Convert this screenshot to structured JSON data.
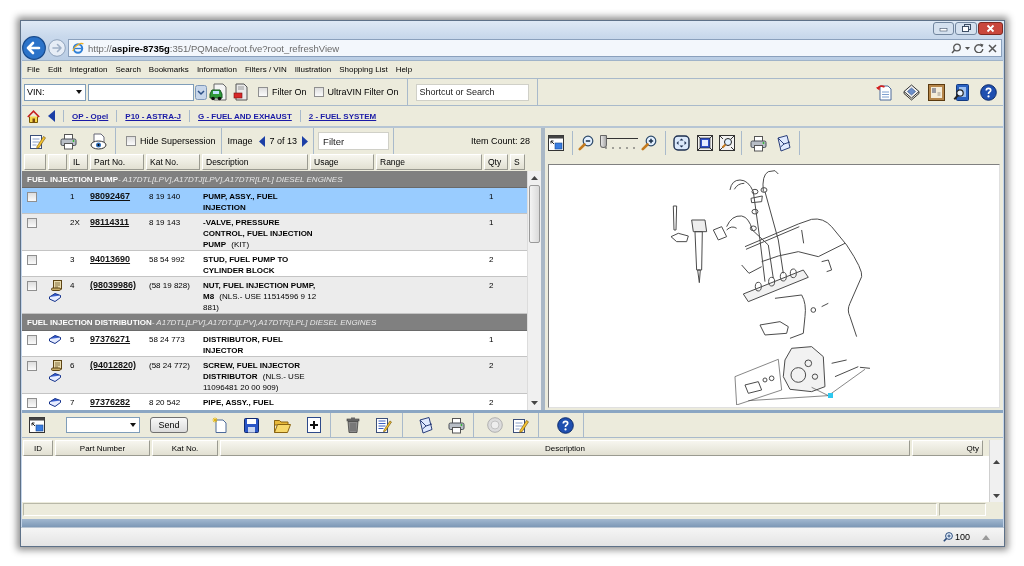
{
  "address_bar": {
    "url": "http://**aspire-8735g**:351/PQMace/root.fve?root_refreshView"
  },
  "menu": [
    "File",
    "Edit",
    "Integration",
    "Search",
    "Bookmarks",
    "Information",
    "Filters / VIN",
    "Illustration",
    "Shopping List",
    "Help"
  ],
  "toolbar": {
    "vin_select": "VIN:",
    "filters": [
      {
        "label": "Filter On",
        "checked": false
      },
      {
        "label": "UltraVIN Filter On",
        "checked": false
      }
    ],
    "search": {
      "placeholder": "Shortcut or Search"
    }
  },
  "breadcrumb": [
    "OP - Opel",
    "P10 - ASTRA-J",
    "G - FUEL AND EXHAUST",
    "2 - FUEL SYSTEM"
  ],
  "parts_list": {
    "hide_supersession": {
      "label": "Hide Supersession",
      "checked": false
    },
    "image_label": "Image",
    "image_position": "7 of 13",
    "filter": {
      "placeholder": "Filter"
    },
    "item_count": "Item Count: 28",
    "columns": [
      "IL",
      "Part No.",
      "Kat No.",
      "Description",
      "Usage",
      "Range",
      "Qty",
      "S"
    ],
    "groups": [
      {
        "name": "FUEL INJECTION PUMP",
        "applies_to": "- A17DTL[LPV],A17DTJ[LPV],A17DTR[LPL] DIESEL ENGINES",
        "rows": [
          {
            "checked": false,
            "selected": true,
            "scroll_icon": false,
            "book_icon": false,
            "il": "1",
            "part_no": "98092467",
            "kat_no": "8 19 140",
            "description": "PUMP, ASSY., FUEL INJECTION",
            "qty": "1"
          },
          {
            "checked": false,
            "selected": false,
            "scroll_icon": false,
            "book_icon": false,
            "il": "2X",
            "part_no": "98114311",
            "kat_no": "8 19 143",
            "description": "-VALVE, PRESSURE CONTROL, FUEL INJECTION PUMP",
            "note": "(KIT)",
            "qty": "1"
          },
          {
            "checked": false,
            "selected": false,
            "scroll_icon": false,
            "book_icon": false,
            "il": "3",
            "part_no": "94013690",
            "kat_no": "58 54 992",
            "description": "STUD, FUEL PUMP TO CYLINDER BLOCK",
            "qty": "2"
          },
          {
            "checked": false,
            "selected": false,
            "scroll_icon": true,
            "book_icon": true,
            "il": "4",
            "part_no": "(98039986)",
            "kat_no": "(58 19 828)",
            "description": "NUT, FUEL INJECTION PUMP, M8",
            "note": "(NLS.- USE 11514596 9 12 881)",
            "qty": "2"
          }
        ]
      },
      {
        "name": "FUEL INJECTION DISTRIBUTION",
        "applies_to": "- A17DTL[LPV],A17DTJ[LPV],A17DTR[LPL] DIESEL ENGINES",
        "rows": [
          {
            "checked": false,
            "selected": false,
            "scroll_icon": false,
            "book_icon": true,
            "il": "5",
            "part_no": "97376271",
            "kat_no": "58 24 773",
            "description": "DISTRIBUTOR, FUEL INJECTOR",
            "qty": "1"
          },
          {
            "checked": false,
            "selected": false,
            "scroll_icon": true,
            "book_icon": true,
            "il": "6",
            "part_no": "(94012820)",
            "kat_no": "(58 24 772)",
            "description": "SCREW, FUEL INJECTOR DISTRIBUTOR",
            "note": "(NLS.- USE 11096481 20 00 909)",
            "qty": "2"
          },
          {
            "checked": false,
            "selected": false,
            "scroll_icon": false,
            "book_icon": true,
            "il": "7",
            "part_no": "97376282",
            "kat_no": "8 20 542",
            "description": "PIPE, ASSY., FUEL",
            "qty": "2"
          }
        ]
      }
    ]
  },
  "illustration": {
    "zoom": {
      "level": 0
    }
  },
  "shopping_list": {
    "send_button": "Send",
    "columns": [
      "ID",
      "Part Number",
      "Kat No.",
      "Description",
      "Qty"
    ]
  },
  "status_bar": {
    "zoom": "100"
  }
}
